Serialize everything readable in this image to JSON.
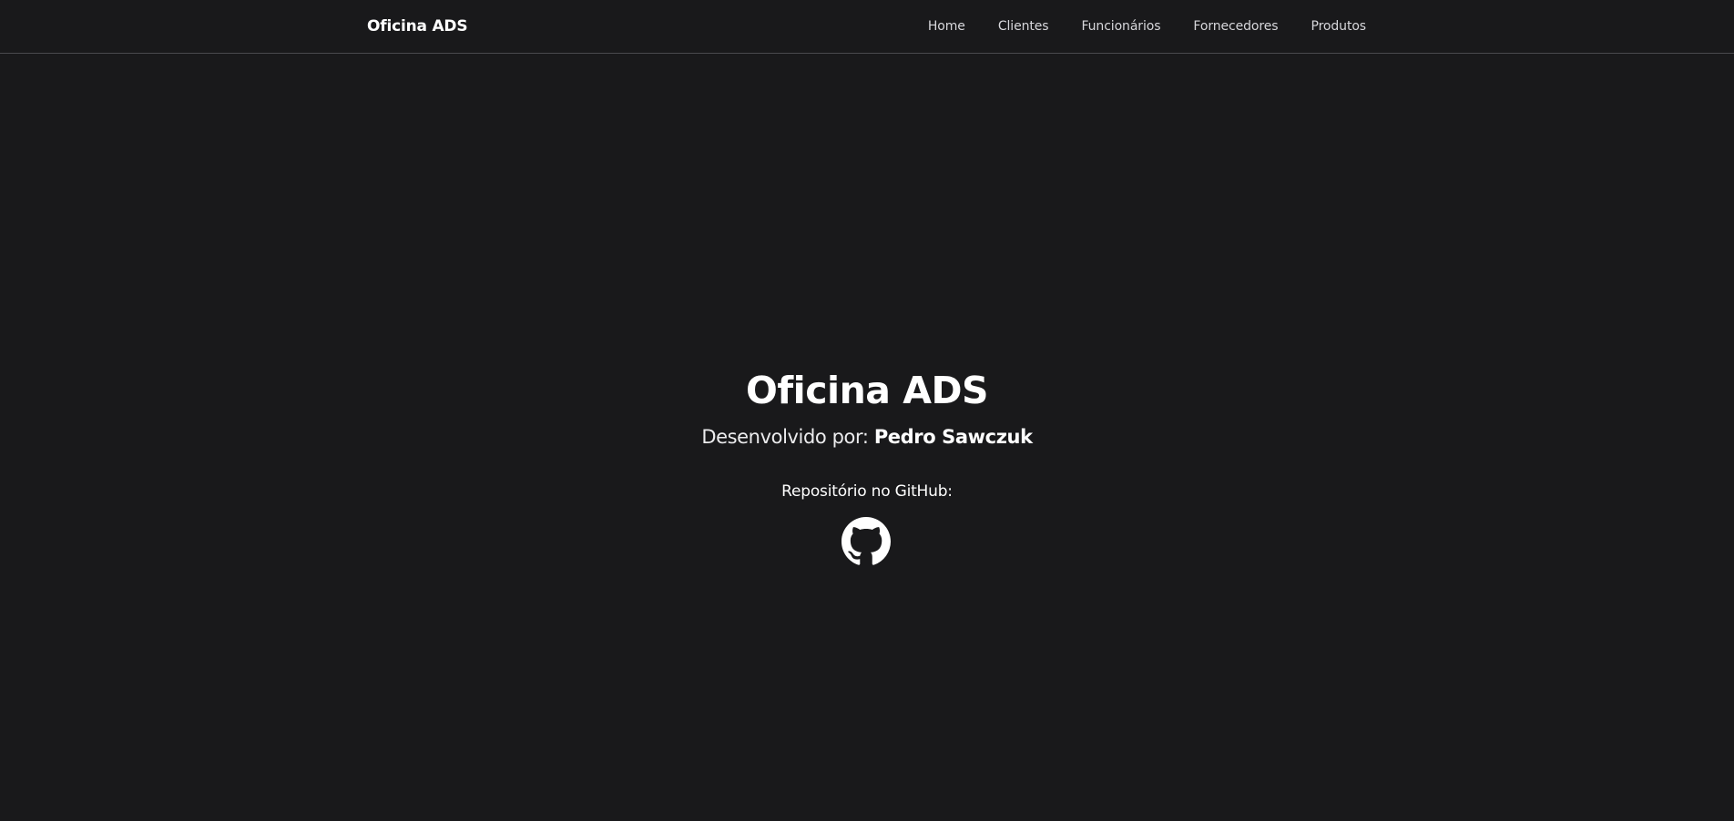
{
  "navbar": {
    "brand": "Oficina ADS",
    "links": [
      {
        "label": "Home"
      },
      {
        "label": "Clientes"
      },
      {
        "label": "Funcionários"
      },
      {
        "label": "Fornecedores"
      },
      {
        "label": "Produtos"
      }
    ]
  },
  "hero": {
    "title": "Oficina ADS",
    "developer_prefix": "Desenvolvido por: ",
    "developer_name": "Pedro Sawczuk",
    "repo_label": "Repositório no GitHub:",
    "repo_icon": "github-icon"
  },
  "colors": {
    "background": "#19191b",
    "text": "#ffffff",
    "nav_text": "#d7d7db",
    "divider": "#4a4a4e"
  }
}
